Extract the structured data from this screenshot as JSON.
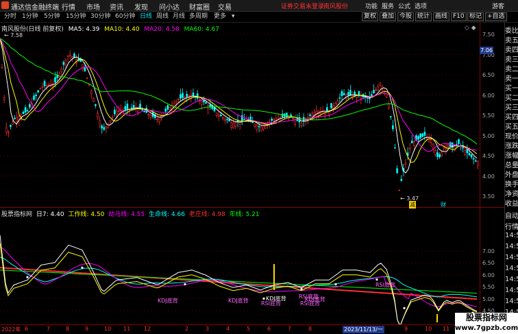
{
  "app": {
    "title": "通达信金融终端"
  },
  "menu": [
    "行情",
    "市场",
    "资讯",
    "发现",
    "问小达",
    "财富圈",
    "交易"
  ],
  "alert": "证券交易未登录",
  "stock_link": "南风股份",
  "top_right": [
    "功能",
    "服务",
    "公式",
    "选项",
    "游客"
  ],
  "toolbar": {
    "timeframes": [
      "分时",
      "1分钟",
      "5分钟",
      "15分钟",
      "30分钟",
      "60分钟",
      "日线",
      "周线",
      "月线",
      "多周期",
      "更多"
    ],
    "active": "日线",
    "right_buttons": [
      "复权",
      "叠加",
      "今股",
      "统计",
      "画线",
      "F10",
      "标记",
      "+自选"
    ]
  },
  "main_header": {
    "name": "南风股份(日线 前复权)",
    "ma": [
      {
        "label": "MA5: 4.39",
        "color": "#ffffff"
      },
      {
        "label": "MA10: 4.40",
        "color": "#ffff00"
      },
      {
        "label": "MA20: 4.58",
        "color": "#ff00ff"
      },
      {
        "label": "MA60: 4.67",
        "color": "#00ff00"
      }
    ]
  },
  "price_axis": [
    "7.50",
    "7.00",
    "6.50",
    "6.00",
    "5.50",
    "5.00",
    "4.50",
    "4.00",
    "3.50"
  ],
  "price_tag": "7.06",
  "high_label": "7.58",
  "low_label": "3.47",
  "event_tags": [
    "减",
    "财"
  ],
  "indicator_header": {
    "name": "股票指标网",
    "items": [
      {
        "label": "日7: 4.40",
        "color": "#ffffff"
      },
      {
        "label": "工作线: 4.50",
        "color": "#ffff00"
      },
      {
        "label": "劫马线: 4.55",
        "color": "#ff00ff"
      },
      {
        "label": "生命线: 4.66",
        "color": "#00ffff"
      },
      {
        "label": "老庄线: 4.98",
        "color": "#ff3030"
      },
      {
        "label": "年线: 5.21",
        "color": "#00ff00"
      }
    ]
  },
  "indicator_axis": [
    "7.00",
    "6.50",
    "6.00",
    "5.50",
    "5.00",
    "4.50",
    "4.00"
  ],
  "signals": [
    "KDJ底背",
    "KDJ底背",
    "KDJ底背",
    "RSI底背",
    "RSI底背",
    "KDJ底背",
    "RSI底背",
    "RSI底背",
    "K"
  ],
  "date_axis": [
    "2022年",
    "6",
    "7",
    "8",
    "9",
    "10",
    "11",
    "12",
    "2023/11/13/一",
    "2",
    "3",
    "4",
    "5",
    "6",
    "7",
    "8",
    "9",
    "10",
    "11",
    "12"
  ],
  "sidebar_top": [
    "委比",
    "卖五",
    "卖四",
    "卖三",
    "卖二",
    "卖一",
    "买一",
    "买二",
    "买三",
    "买四",
    "买五",
    "现价",
    "涨跌",
    "涨幅",
    "总量",
    "外盘",
    "换手",
    "净资",
    "收益"
  ],
  "sidebar_bottom": [
    "自动",
    "行情",
    "14:5",
    "14:5",
    "14:5",
    "14:5",
    "14:5",
    "14:5",
    "14:5",
    "14:5"
  ],
  "watermark": [
    "股票指标网",
    "www.7gpzb.com"
  ],
  "colors": {
    "bg": "#000000",
    "up": "#ff3030",
    "down": "#00ffff",
    "grid": "#8b0000"
  }
}
